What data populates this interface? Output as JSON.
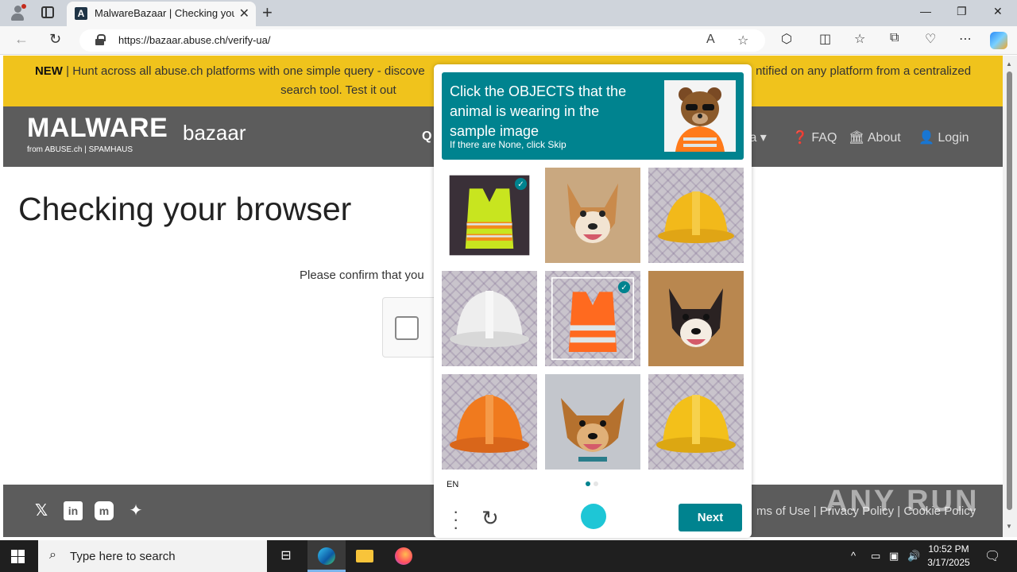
{
  "browser": {
    "tab_title": "MalwareBazaar | Checking your b",
    "url": "https://bazaar.abuse.ch/verify-ua/",
    "new_tab": "+",
    "close_tab": "✕"
  },
  "site": {
    "banner_new": "NEW",
    "banner_text_1": "| Hunt across all abuse.ch platforms with one simple query - discove",
    "banner_text_2": "ntified on any platform from a centralized",
    "banner_text_3": "search tool. Test it out",
    "logo_main": "MALWARE",
    "logo_sub": "bazaar",
    "logo_from": "from ABUSE.ch | SPAMHAUS",
    "nav": {
      "data_partial": "ta ▾",
      "faq": "FAQ",
      "about": "About",
      "login": "Login"
    },
    "page_title": "Checking your browser",
    "confirm_text": "Please confirm that you",
    "footer_links": "ms of Use  |  Privacy Policy  |  Cookie Policy",
    "watermark": "ANY RUN"
  },
  "captcha": {
    "title": "Click the OBJECTS that the animal is wearing in the sample image",
    "subtitle": "If there are None, click Skip",
    "sample_image": "bear-wearing-sunglasses-and-safety-vest",
    "tiles": [
      {
        "label": "safety-vest-yellow",
        "selected": true
      },
      {
        "label": "dog",
        "selected": false
      },
      {
        "label": "hard-hat-yellow",
        "selected": false
      },
      {
        "label": "hard-hat-white",
        "selected": false
      },
      {
        "label": "safety-vest-orange",
        "selected": true
      },
      {
        "label": "dog",
        "selected": false
      },
      {
        "label": "hard-hat-orange",
        "selected": false
      },
      {
        "label": "dog",
        "selected": false
      },
      {
        "label": "hard-hat-yellow",
        "selected": false
      }
    ],
    "language": "EN",
    "next_label": "Next",
    "check_mark": "✓"
  },
  "taskbar": {
    "search_placeholder": "Type here to search",
    "time": "10:52 PM",
    "date": "3/17/2025"
  },
  "colors": {
    "banner": "#f0c31c",
    "header": "#5c5c5c",
    "captcha_accent": "#00838f"
  }
}
